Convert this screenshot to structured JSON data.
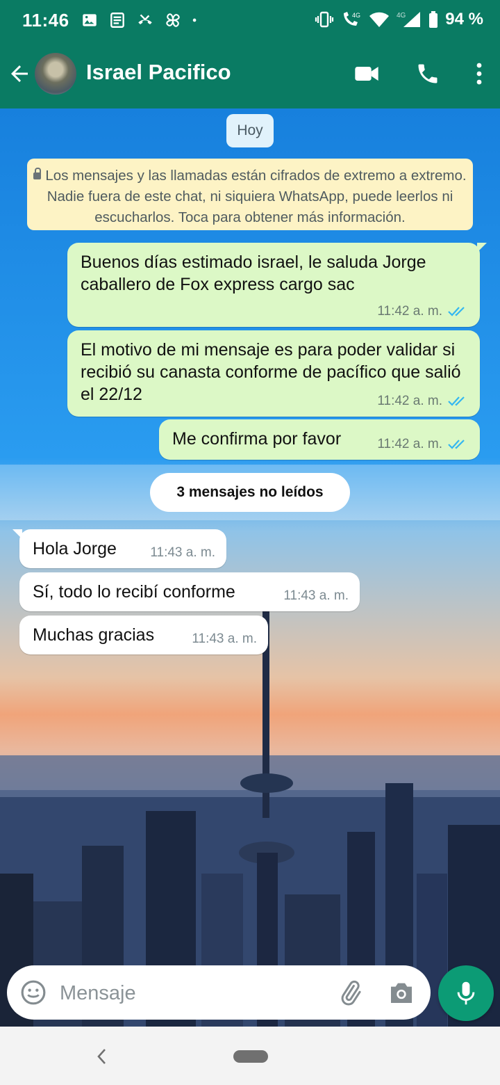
{
  "status_bar": {
    "time": "11:46",
    "network": "4G",
    "battery": "94 %",
    "left_icons": [
      "image-icon",
      "news-icon",
      "missed-call-icon",
      "pinwheel-icon",
      "dot-icon"
    ],
    "right_icons": [
      "vibrate-icon",
      "volte-call-icon",
      "wifi-icon",
      "signal-icon",
      "battery-icon"
    ]
  },
  "header": {
    "contact_name": "Israel Pacifico",
    "back_icon": "arrow-left-icon",
    "actions": [
      "video-call-icon",
      "voice-call-icon",
      "more-vert-icon"
    ]
  },
  "chat": {
    "day_label": "Hoy",
    "encryption_notice": "Los mensajes y las llamadas están cifrados de extremo a extremo. Nadie fuera de este chat, ni siquiera WhatsApp, puede leerlos ni escucharlos. Toca para obtener más información.",
    "outgoing": [
      {
        "text": "Buenos días estimado israel, le saluda Jorge caballero de Fox express cargo sac",
        "time": "11:42 a. m."
      },
      {
        "text": "El motivo de mi mensaje es para poder validar si recibió su canasta conforme de pacífico que salió el 22/12",
        "time": "11:42 a. m."
      },
      {
        "text": "Me confirma por favor",
        "time": "11:42 a. m."
      }
    ],
    "unread_label": "3 mensajes no leídos",
    "incoming": [
      {
        "text": "Hola Jorge",
        "time": "11:43 a. m."
      },
      {
        "text": "Sí, todo lo recibí conforme",
        "time": "11:43 a. m."
      },
      {
        "text": "Muchas gracias",
        "time": "11:43 a. m."
      }
    ]
  },
  "composer": {
    "placeholder": "Mensaje"
  },
  "colors": {
    "header": "#0a7b63",
    "outgoing_bubble": "#dcf8c6",
    "incoming_bubble": "#ffffff",
    "read_ticks": "#34b7f1",
    "mic_button": "#0c9b75"
  }
}
